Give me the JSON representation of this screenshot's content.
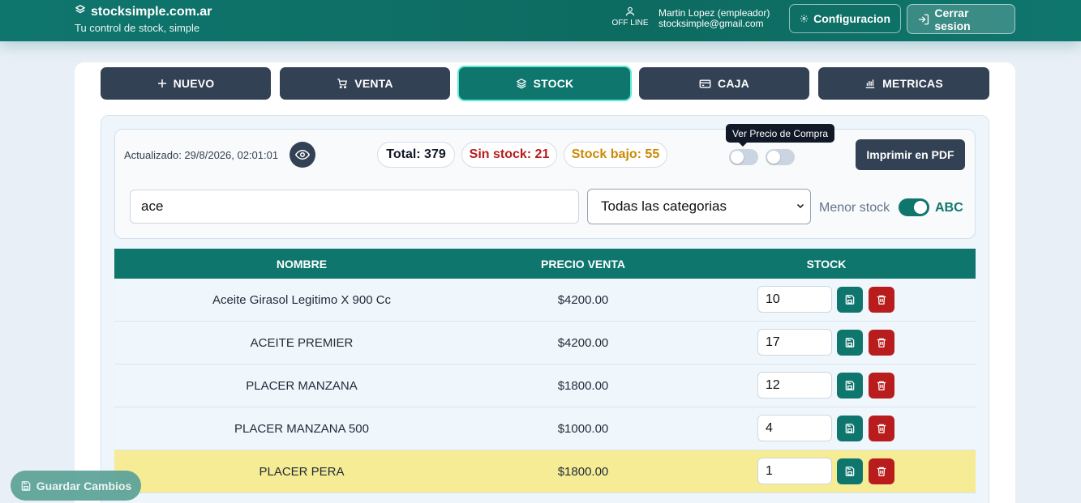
{
  "header": {
    "brand": "stocksimple.com.ar",
    "tagline": "Tu control de stock, simple",
    "status": "OFF LINE",
    "user_name": "Martin Lopez (empleador)",
    "user_email": "stocksimple@gmail.com",
    "config_label": "Configuracion",
    "logout_label": "Cerrar sesion"
  },
  "tabs": [
    {
      "label": "NUEVO",
      "icon": "plus-icon"
    },
    {
      "label": "VENTA",
      "icon": "cart-icon"
    },
    {
      "label": "STOCK",
      "icon": "layers-icon",
      "active": true
    },
    {
      "label": "CAJA",
      "icon": "cash-icon"
    },
    {
      "label": "METRICAS",
      "icon": "bar-chart-icon"
    }
  ],
  "toolbar": {
    "updated": "Actualizado: 29/8/2026, 02:01:01",
    "total": "Total: 379",
    "sin_stock": "Sin stock: 21",
    "stock_bajo": "Stock bajo: 55",
    "tooltip": "Ver Precio de Compra",
    "pdf_label": "Imprimir en PDF",
    "search_value": "ace",
    "category_selected": "Todas las categorias",
    "sort_left": "Menor stock",
    "sort_right": "ABC"
  },
  "table": {
    "columns": [
      "NOMBRE",
      "PRECIO VENTA",
      "STOCK"
    ],
    "rows": [
      {
        "nombre": "Aceite Girasol Legitimo X 900 Cc",
        "precio": "$4200.00",
        "stock": "10"
      },
      {
        "nombre": "ACEITE PREMIER",
        "precio": "$4200.00",
        "stock": "17"
      },
      {
        "nombre": "PLACER MANZANA",
        "precio": "$1800.00",
        "stock": "12"
      },
      {
        "nombre": "PLACER MANZANA 500",
        "precio": "$1000.00",
        "stock": "4"
      },
      {
        "nombre": "PLACER PERA",
        "precio": "$1800.00",
        "stock": "1",
        "low": true
      }
    ]
  },
  "floating_button": "Guardar Cambios",
  "colors": {
    "primary": "#0f766e",
    "dark": "#334155",
    "danger": "#b91c1c",
    "warning": "#ca8a04",
    "low_stock_row": "#f6ec95"
  }
}
